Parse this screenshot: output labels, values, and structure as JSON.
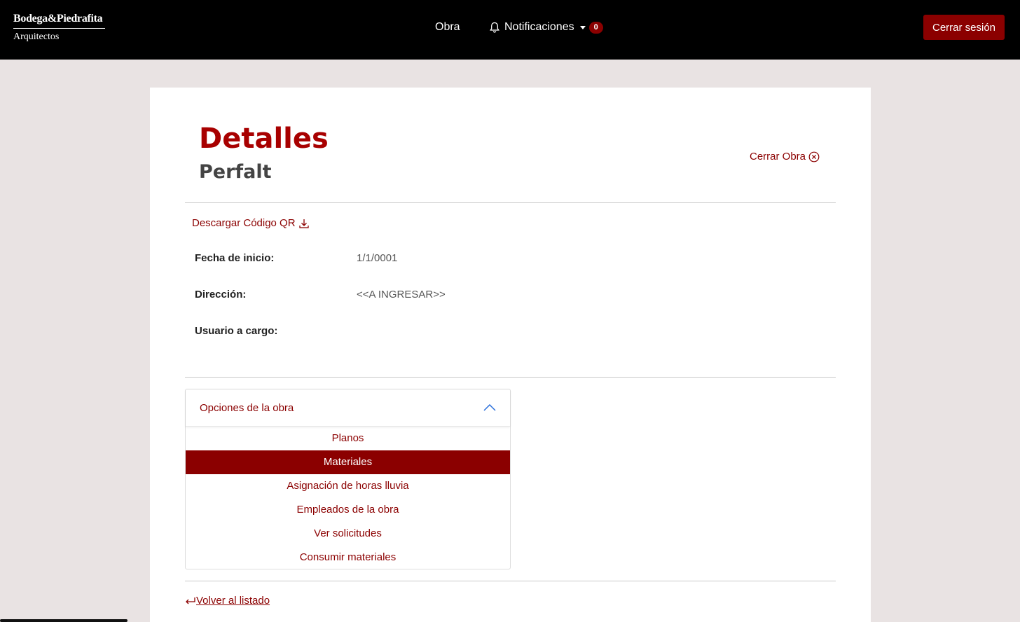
{
  "navbar": {
    "brand_name": "Bodega&Piedrafita",
    "brand_sub": "Arquitectos",
    "obra_label": "Obra",
    "notifications_label": "Notificaciones",
    "notifications_count": "0",
    "logout_label": "Cerrar sesión"
  },
  "page": {
    "title": "Detalles",
    "subtitle": "Perfalt",
    "close_obra_label": "Cerrar Obra",
    "qr_label": "Descargar Código QR"
  },
  "details": [
    {
      "label": "Fecha de inicio:",
      "value": "1/1/0001"
    },
    {
      "label": "Dirección:",
      "value": "<<A INGRESAR>>"
    },
    {
      "label": "Usuario a cargo:",
      "value": ""
    }
  ],
  "options": {
    "title": "Opciones de la obra",
    "items": [
      {
        "label": "Planos",
        "active": false
      },
      {
        "label": "Materiales",
        "active": true
      },
      {
        "label": "Asignación de horas lluvia",
        "active": false
      },
      {
        "label": "Empleados de la obra",
        "active": false
      },
      {
        "label": "Ver solicitudes",
        "active": false
      },
      {
        "label": "Consumir materiales",
        "active": false
      }
    ]
  },
  "back_label": "Volver al listado",
  "colors": {
    "accent": "#8b0000",
    "title": "#a80000",
    "background": "#e9e3e3",
    "navbar": "#000000"
  }
}
